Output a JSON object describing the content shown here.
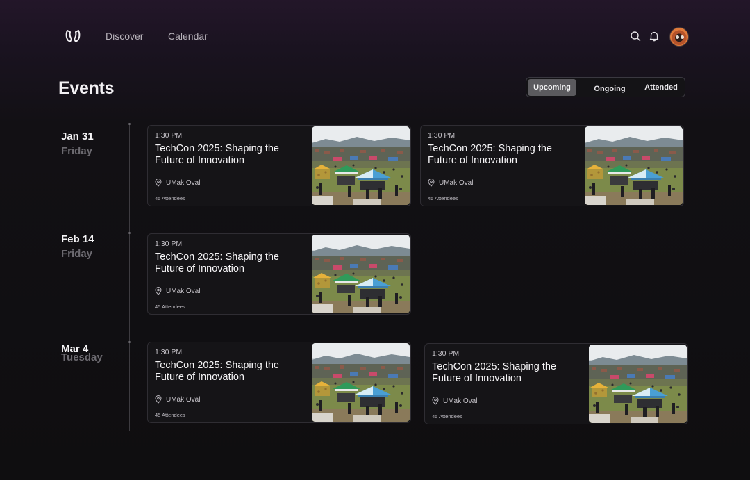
{
  "nav": {
    "discover": "Discover",
    "calendar": "Calendar"
  },
  "page": {
    "title": "Events"
  },
  "tabs": {
    "upcoming": "Upcoming",
    "ongoing": "Ongoing",
    "attended": "Attended",
    "selected": "Upcoming"
  },
  "groups": [
    {
      "date": "Jan 31",
      "day": "Friday",
      "events": [
        {
          "time": "1:30 PM",
          "title": "TechCon 2025: Shaping the Future of Innovation",
          "location": "UMak Oval",
          "attendees": "45 Attendees"
        },
        {
          "time": "1:30 PM",
          "title": "TechCon 2025: Shaping the Future of Innovation",
          "location": "UMak Oval",
          "attendees": "45 Attendees"
        }
      ]
    },
    {
      "date": "Feb 14",
      "day": "Friday",
      "events": [
        {
          "time": "1:30 PM",
          "title": "TechCon 2025: Shaping the Future of Innovation",
          "location": "UMak Oval",
          "attendees": "45 Attendees"
        }
      ]
    },
    {
      "date": "Mar 4",
      "day": "Tuesday",
      "events": [
        {
          "time": "1:30 PM",
          "title": "TechCon 2025: Shaping the Future of Innovation",
          "location": "UMak Oval",
          "attendees": "45 Attendees"
        },
        {
          "time": "1:30 PM",
          "title": "TechCon 2025: Shaping the Future of Innovation",
          "location": "UMak Oval",
          "attendees": "45 Attendees"
        }
      ]
    }
  ],
  "colors": {
    "background": "#0f0e10",
    "header_gradient": "#231629",
    "card_bg": "#151417",
    "muted_text": "#6c6a70",
    "active_tab": "#5b5a5e"
  },
  "icons": {
    "logo": "hands-logo-icon",
    "search": "search-icon",
    "notifications": "bell-icon",
    "location": "map-pin-icon"
  }
}
